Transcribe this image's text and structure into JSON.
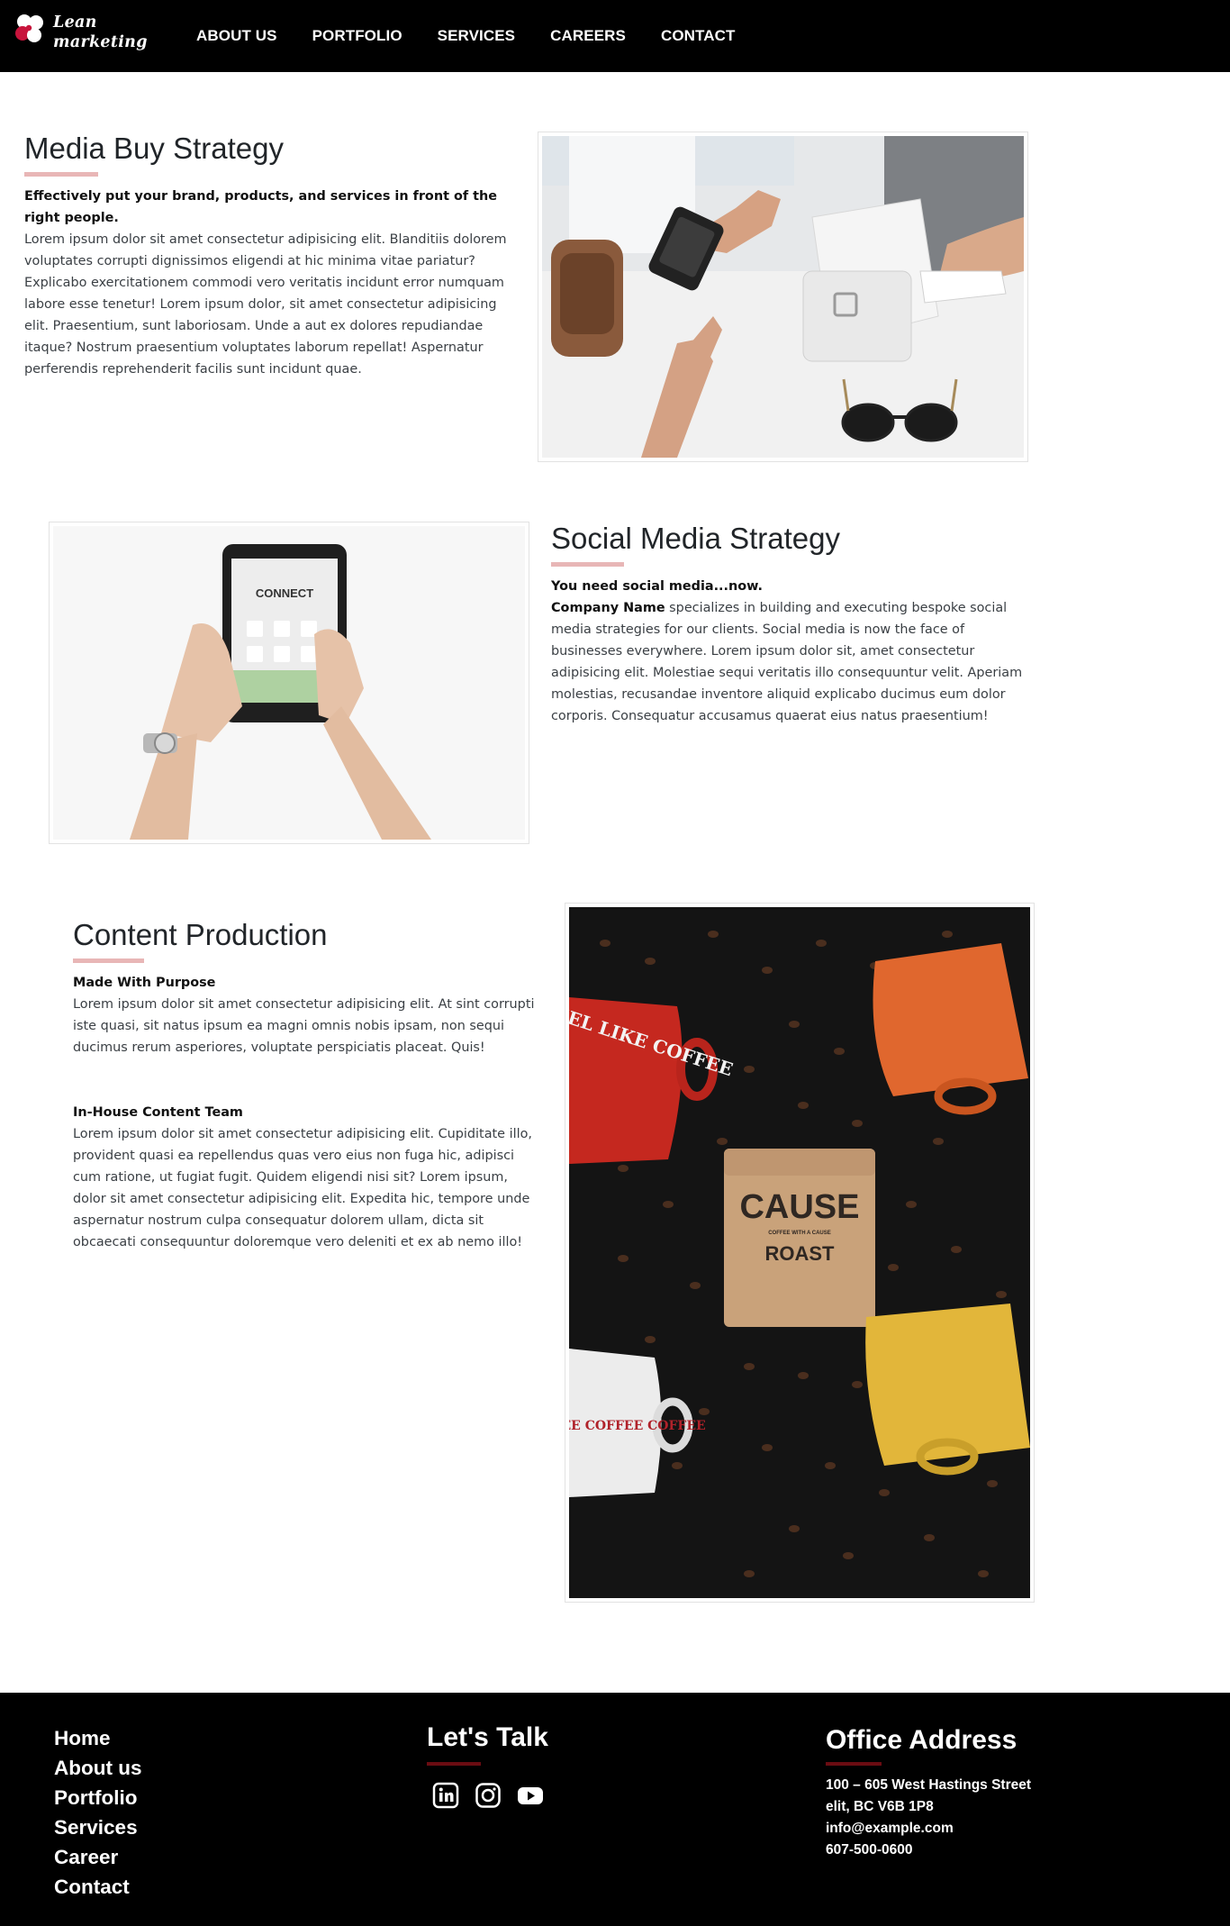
{
  "brand": {
    "line1": "Lean",
    "line2": "marketing"
  },
  "nav": [
    {
      "label": "ABOUT US"
    },
    {
      "label": "PORTFOLIO"
    },
    {
      "label": "SERVICES"
    },
    {
      "label": "CAREERS"
    },
    {
      "label": "CONTACT"
    }
  ],
  "colors": {
    "background": "#ffffff",
    "navbar": "#000000",
    "accent_underline": "#e8b6b6",
    "footer": "#000000",
    "footer_underline": "#6a0c12"
  },
  "sections": {
    "media_buy": {
      "title": "Media Buy Strategy",
      "lead": "Effectively put your brand, products, and services in front of the right people.",
      "body": "Lorem ipsum dolor sit amet consectetur adipisicing elit. Blanditiis dolorem voluptates corrupti dignissimos eligendi at hic minima vitae pariatur? Explicabo exercitationem commodi vero veritatis incidunt error numquam labore esse tenetur! Lorem ipsum dolor, sit amet consectetur adipisicing elit. Praesentium, sunt laboriosam. Unde a aut ex dolores repudiandae itaque? Nostrum praesentium voluptates laborum repellat! Aspernatur perferendis reprehenderit facilis sunt incidunt quae."
    },
    "social_media": {
      "title": "Social Media Strategy",
      "lead": "You need social media...now.",
      "company": "Company Name",
      "body": " specializes in building and executing bespoke social media strategies for our clients. Social media is now the face of businesses everywhere. Lorem ipsum dolor sit, amet consectetur adipisicing elit. Molestiae sequi veritatis illo consequuntur velit. Aperiam molestias, recusandae inventore aliquid explicabo ducimus eum dolor corporis. Consequatur accusamus quaerat eius natus praesentium!",
      "tablet_screen_text": "CONNECT"
    },
    "content_production": {
      "title": "Content Production",
      "lead1": "Made With Purpose",
      "body1": "Lorem ipsum dolor sit amet consectetur adipisicing elit. At sint corrupti iste quasi, sit natus ipsum ea magni omnis nobis ipsam, non sequi ducimus rerum asperiores, voluptate perspiciatis placeat. Quis!",
      "lead2": "In-House Content Team",
      "body2": "Lorem ipsum dolor sit amet consectetur adipisicing elit. Cupiditate illo, provident quasi ea repellendus quas vero eius non fuga hic, adipisci cum ratione, ut fugiat fugit. Quidem eligendi nisi sit? Lorem ipsum, dolor sit amet consectetur adipisicing elit. Expedita hic, tempore unde aspernatur nostrum culpa consequatur dolorem ullam, dicta sit obcaecati consequuntur doloremque vero deleniti et ex ab nemo illo!",
      "bag_line1": "CAUSE",
      "bag_line2": "COFFEE WITH A CAUSE",
      "bag_line3": "ROAST",
      "mug_text_a": "I FEEL LIKE COFFEE",
      "mug_text_b": "COFFEE COFFEE COFFEE"
    }
  },
  "footer": {
    "links": [
      {
        "label": "Home"
      },
      {
        "label": "About us"
      },
      {
        "label": "Portfolio"
      },
      {
        "label": "Services"
      },
      {
        "label": "Career"
      },
      {
        "label": "Contact"
      }
    ],
    "lets_talk": "Let's Talk",
    "social_icons": [
      "linkedin-icon",
      "instagram-icon",
      "youtube-icon"
    ],
    "office_title": "Office Address",
    "address_line1": "100 – 605 West Hastings Street",
    "address_line2": "elit, BC V6B 1P8",
    "email": "info@example.com",
    "phone": "607-500-0600"
  }
}
